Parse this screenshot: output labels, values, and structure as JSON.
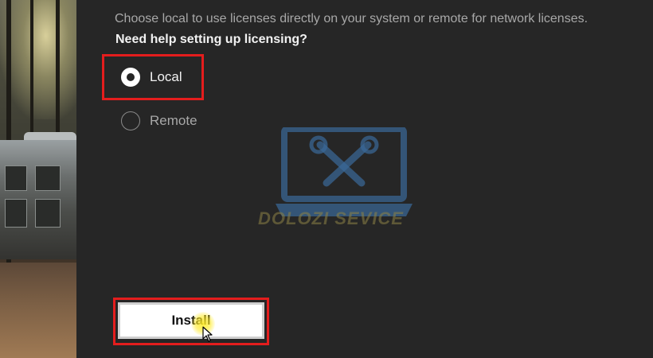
{
  "licensing": {
    "description": "Choose local to use licenses directly on your system or remote for network licenses.",
    "help_link": "Need help setting up licensing?",
    "options": [
      {
        "label": "Local",
        "selected": true
      },
      {
        "label": "Remote",
        "selected": false
      }
    ]
  },
  "actions": {
    "install_label": "Install"
  },
  "watermark": {
    "text": "DOLOZI SEVICE"
  },
  "colors": {
    "panel_background": "#262626",
    "highlight_red": "#e41d1d",
    "button_background": "#ffffff",
    "cursor_highlight": "#ffeb28",
    "watermark_blue": "#3a6a9a"
  },
  "icons": {
    "watermark_logo": "laptop-tools-icon",
    "cursor": "mouse-pointer-icon"
  }
}
